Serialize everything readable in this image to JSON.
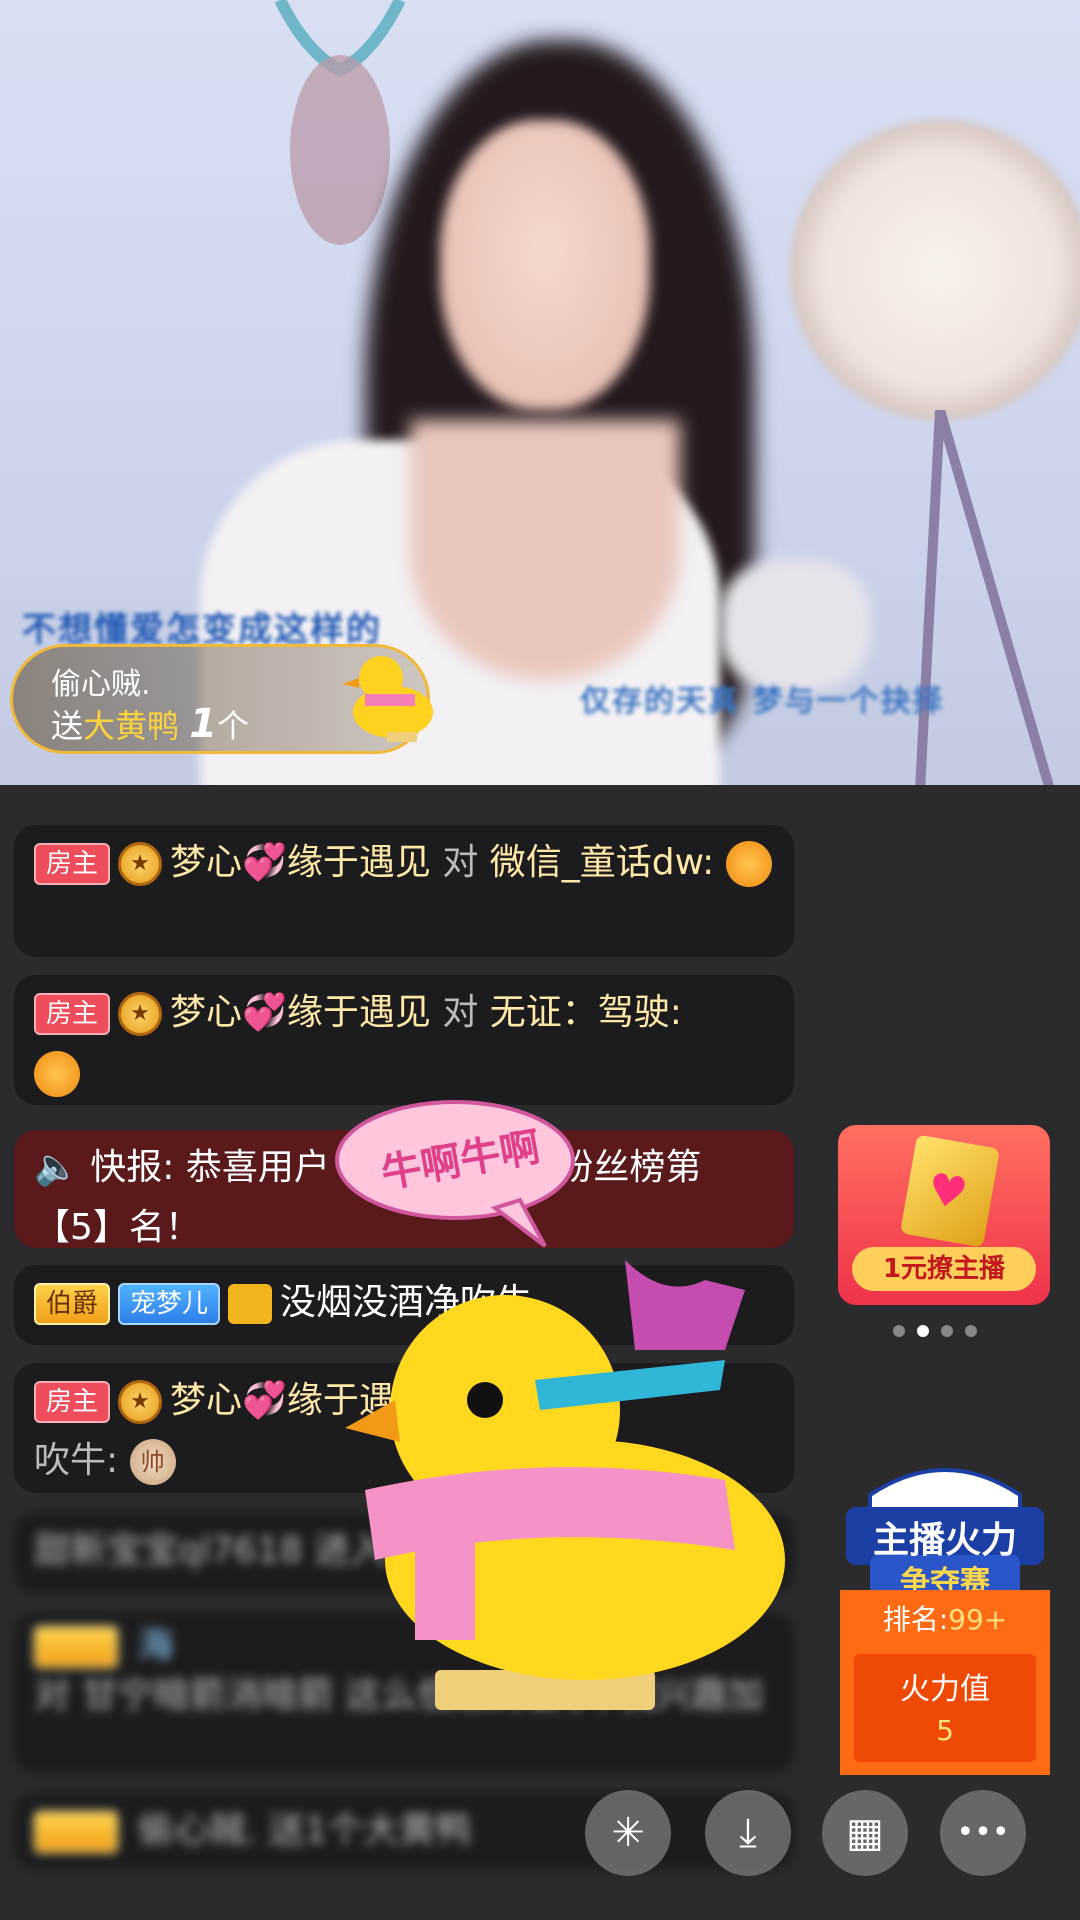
{
  "video": {
    "song_overlay_left": "不想懂爱怎变成这样的",
    "song_overlay_right": "仅存的天真 梦与一个抉择"
  },
  "gift_banner": {
    "sender": "偷心贼.",
    "prefix": "送",
    "gift": "大黄鸭",
    "count": "1",
    "unit": "个"
  },
  "sticker": {
    "text": "牛啊牛啊"
  },
  "chat": {
    "messages": [
      {
        "tag": "房主",
        "user": "梦心",
        "user_suffix": "缘于遇见",
        "to": "对",
        "target": "微信_童话dw:"
      },
      {
        "tag": "房主",
        "user": "梦心",
        "user_suffix": "缘于遇见",
        "to": "对",
        "target": "无证：驾驶:"
      },
      {
        "prefix": "快报: 恭喜用户",
        "suffix": "成功进驻本场粉丝榜第【5】名！"
      },
      {
        "tag": "伯爵",
        "fan_badge": "宠梦儿",
        "text": "没烟没酒净吹牛"
      },
      {
        "tag": "房主",
        "user": "梦心",
        "user_suffix": "缘于遇见",
        "rest": "吹牛:",
        "emoji": "帅"
      },
      {
        "text": "甜新宝宝ql7618 进入直播间"
      },
      {
        "text": "对 甘宁暗箭消暗箭 这么低级的骗子, 我兴趣加",
        "extra": "海"
      },
      {
        "text": "偷心贼. 送1个大黄鸭"
      }
    ]
  },
  "promo": {
    "label": "1元撩主播",
    "dots": 4,
    "active_dot": 1
  },
  "firepower": {
    "title_line1": "主播火力",
    "title_line2": "争夺赛",
    "rank_label": "排名:",
    "rank_value": "99+",
    "value_label": "火力值",
    "value": "5"
  },
  "bottom_bar": {
    "buttons": [
      {
        "icon": "sparkle-icon",
        "glyph": "✳"
      },
      {
        "icon": "download-icon",
        "glyph": "⤓"
      },
      {
        "icon": "grid-icon",
        "glyph": "▦"
      },
      {
        "icon": "more-icon",
        "glyph": "•••"
      }
    ]
  }
}
